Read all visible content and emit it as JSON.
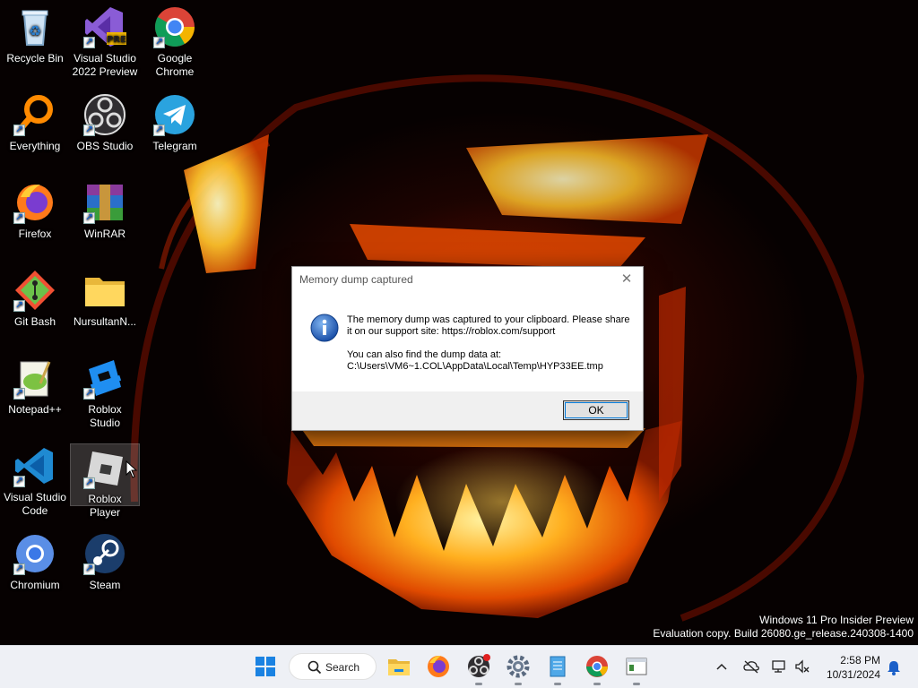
{
  "desktop": {
    "icons": [
      {
        "label": "Recycle Bin",
        "icon": "recycle-bin-icon"
      },
      {
        "label": "Visual Studio 2022 Preview",
        "icon": "visual-studio-preview-icon",
        "badge": "PRE"
      },
      {
        "label": "Google Chrome",
        "icon": "chrome-icon"
      },
      {
        "label": "Everything",
        "icon": "everything-search-icon"
      },
      {
        "label": "OBS Studio",
        "icon": "obs-icon"
      },
      {
        "label": "Telegram",
        "icon": "telegram-icon"
      },
      {
        "label": "Firefox",
        "icon": "firefox-icon"
      },
      {
        "label": "WinRAR",
        "icon": "winrar-icon"
      },
      {
        "label": "Git Bash",
        "icon": "git-bash-icon"
      },
      {
        "label": "NursultanN...",
        "icon": "folder-icon"
      },
      {
        "label": "Notepad++",
        "icon": "notepadpp-icon"
      },
      {
        "label": "Roblox Studio",
        "icon": "roblox-studio-icon"
      },
      {
        "label": "Visual Studio Code",
        "icon": "vscode-icon"
      },
      {
        "label": "Roblox Player",
        "icon": "roblox-player-icon"
      },
      {
        "label": "Chromium",
        "icon": "chromium-icon"
      },
      {
        "label": "Steam",
        "icon": "steam-icon"
      }
    ],
    "watermark": {
      "line1": "Windows 11 Pro Insider Preview",
      "line2": "Evaluation copy. Build 26080.ge_release.240308-1400"
    }
  },
  "dialog": {
    "title": "Memory dump captured",
    "close_glyph": "✕",
    "message_line1": "The memory dump was captured to your clipboard. Please share it on our support site: https://roblox.com/support",
    "message_line2": "You can also find the dump data at: C:\\Users\\VM6~1.COL\\AppData\\Local\\Temp\\HYP33EE.tmp",
    "ok_label": "OK"
  },
  "taskbar": {
    "search_label": "Search",
    "apps": [
      "start-icon",
      "search-icon",
      "file-explorer-icon",
      "firefox-icon",
      "obs-icon",
      "settings-icon",
      "notepad-icon",
      "chrome-icon",
      "dialog-app-icon"
    ],
    "tray": [
      "chevron-up-icon",
      "onedrive-icon",
      "network-icon",
      "volume-icon",
      "notification-bell-icon"
    ],
    "time": "2:58 PM",
    "date": "10/31/2024"
  }
}
